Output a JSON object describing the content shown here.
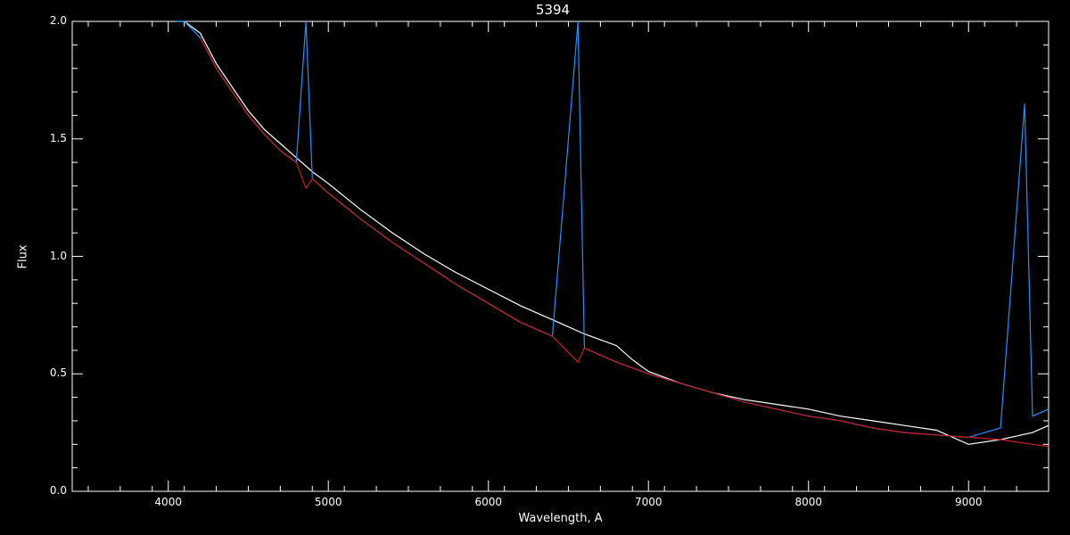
{
  "chart_data": {
    "type": "line",
    "title": "5394",
    "xlabel": "Wavelength, A",
    "ylabel": "Flux",
    "xlim": [
      3400,
      9500
    ],
    "ylim": [
      0.0,
      2.0
    ],
    "x_ticks": [
      4000,
      5000,
      6000,
      7000,
      8000,
      9000
    ],
    "x_tick_labels": [
      "4000",
      "5000",
      "6000",
      "7000",
      "8000",
      "9000"
    ],
    "y_ticks": [
      0.0,
      0.5,
      1.0,
      1.5,
      2.0
    ],
    "y_tick_labels": [
      "0.0",
      "0.5",
      "1.0",
      "1.5",
      "2.0"
    ],
    "grid": false,
    "background": "#000000",
    "series": [
      {
        "color": "#ffffff",
        "x": [
          4050,
          4100,
          4200,
          4300,
          4400,
          4500,
          4600,
          4700,
          4800,
          4900,
          5000,
          5200,
          5400,
          5600,
          5800,
          6000,
          6200,
          6400,
          6600,
          6800,
          6900,
          7000,
          7200,
          7400,
          7600,
          7800,
          8000,
          8200,
          8400,
          8600,
          8800,
          9000,
          9200,
          9400,
          9500
        ],
        "y": [
          2.0,
          2.0,
          1.95,
          1.82,
          1.72,
          1.62,
          1.54,
          1.48,
          1.42,
          1.36,
          1.31,
          1.2,
          1.1,
          1.01,
          0.93,
          0.86,
          0.79,
          0.73,
          0.67,
          0.62,
          0.56,
          0.51,
          0.46,
          0.42,
          0.39,
          0.37,
          0.35,
          0.32,
          0.3,
          0.28,
          0.26,
          0.2,
          0.22,
          0.25,
          0.28
        ]
      },
      {
        "color": "#1e90ff",
        "x": [
          4050,
          4100,
          4200,
          4300,
          4400,
          4500,
          4600,
          4700,
          4800,
          4860,
          4900,
          5000,
          5200,
          5400,
          5600,
          5800,
          6000,
          6200,
          6400,
          6560,
          6600,
          6800,
          7000,
          7200,
          7400,
          7600,
          7800,
          8000,
          8200,
          8400,
          8600,
          8800,
          9000,
          9200,
          9350,
          9400,
          9500
        ],
        "y": [
          2.0,
          2.0,
          1.93,
          1.8,
          1.7,
          1.6,
          1.52,
          1.45,
          1.4,
          2.0,
          1.33,
          1.27,
          1.16,
          1.06,
          0.97,
          0.88,
          0.8,
          0.72,
          0.66,
          2.0,
          0.61,
          0.55,
          0.5,
          0.46,
          0.42,
          0.38,
          0.35,
          0.32,
          0.3,
          0.27,
          0.25,
          0.24,
          0.23,
          0.27,
          1.65,
          0.32,
          0.35
        ]
      },
      {
        "color": "#c81e1e",
        "x": [
          4200,
          4300,
          4400,
          4500,
          4600,
          4700,
          4800,
          4860,
          4900,
          5000,
          5200,
          5400,
          5600,
          5800,
          6000,
          6200,
          6400,
          6560,
          6600,
          6800,
          7000,
          7200,
          7400,
          7600,
          7800,
          8000,
          8200,
          8400,
          8600,
          8800,
          9000,
          9200,
          9400,
          9500
        ],
        "y": [
          1.93,
          1.8,
          1.7,
          1.6,
          1.52,
          1.45,
          1.4,
          1.29,
          1.33,
          1.27,
          1.16,
          1.06,
          0.97,
          0.88,
          0.8,
          0.72,
          0.66,
          0.55,
          0.61,
          0.55,
          0.5,
          0.46,
          0.42,
          0.38,
          0.35,
          0.32,
          0.3,
          0.27,
          0.25,
          0.24,
          0.23,
          0.22,
          0.2,
          0.19
        ]
      }
    ]
  }
}
